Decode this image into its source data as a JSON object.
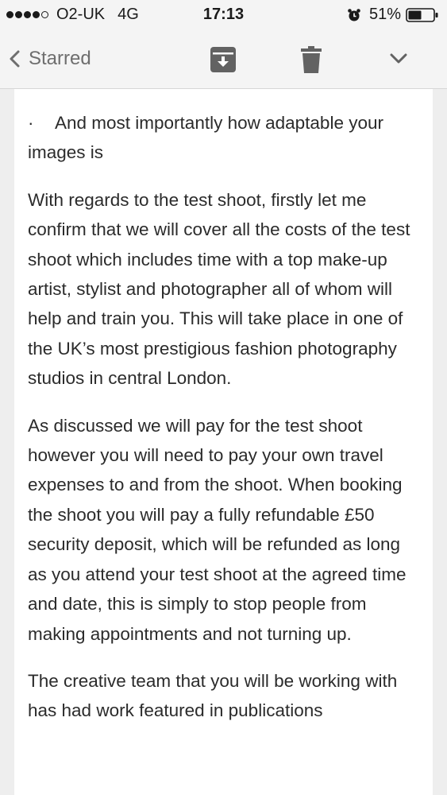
{
  "status_bar": {
    "carrier": "O2-UK",
    "network": "4G",
    "time": "17:13",
    "battery": "51%",
    "signal_strength": 4,
    "signal_max": 5
  },
  "nav": {
    "back_label": "Starred",
    "back_icon": "chevron-left-icon",
    "archive_icon": "archive-icon",
    "trash_icon": "trash-icon",
    "more_icon": "chevron-down-icon",
    "accent_color": "#6e6e6e"
  },
  "email": {
    "bullet_symbol": "·",
    "bullet_text": "And most importantly how adaptable your images is",
    "paragraphs": [
      "With regards to the test shoot, firstly let me confirm that we will cover all the costs of the test shoot which includes time with a top make-up artist, stylist and photographer all of whom will help and train you. This will take place in one of the UK’s most prestigious fashion photography studios in central London.",
      "As discussed we will pay for the test shoot however you will need to pay your own travel expenses to and from the shoot. When booking the shoot you will pay a fully refundable £50 security deposit, which will be refunded as long as you attend your test shoot at the agreed time and date, this is simply to stop people from making appointments and not turning up.",
      "The creative team that you will be working with has had work featured in publications"
    ]
  }
}
